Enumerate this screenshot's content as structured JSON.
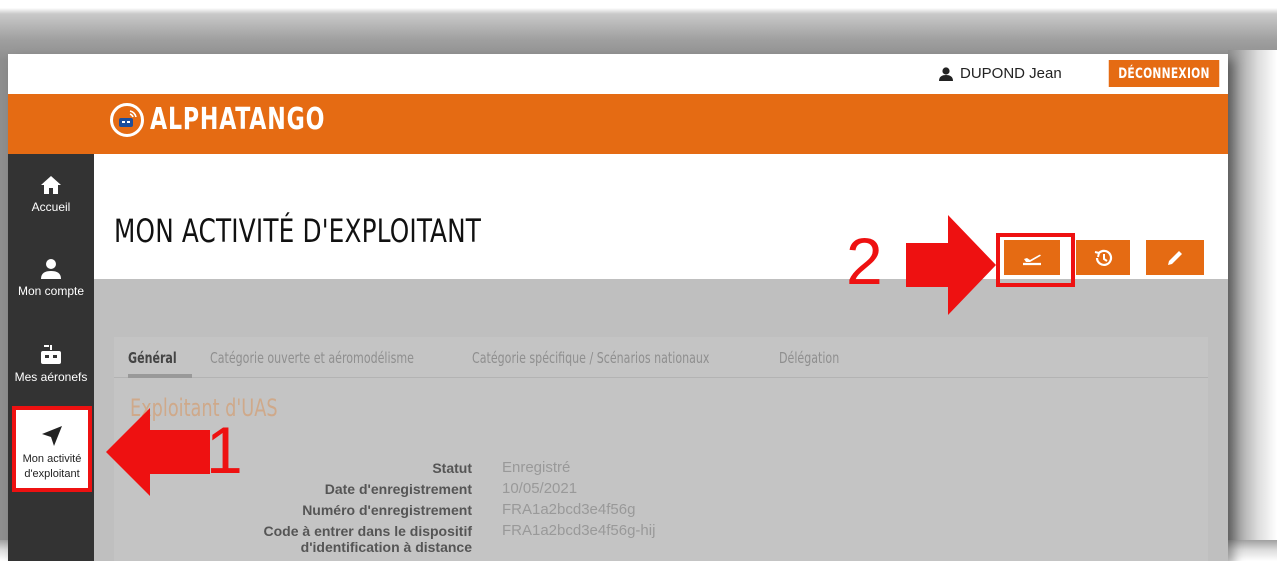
{
  "userbar": {
    "user_name": "DUPOND Jean",
    "logout_label": "DÉCONNEXION"
  },
  "header": {
    "logo_text": "ALPHATANGO"
  },
  "sidebar": {
    "items": [
      {
        "label": "Accueil",
        "icon": "home-icon"
      },
      {
        "label": "Mon compte",
        "icon": "user-icon"
      },
      {
        "label": "Mes aéronefs",
        "icon": "drone-icon"
      },
      {
        "label_line1": "Mon activité",
        "label_line2": "d'exploitant",
        "icon": "navigation-arrow-icon",
        "active": true
      }
    ]
  },
  "main": {
    "title": "MON ACTIVITÉ D'EXPLOITANT",
    "actions": [
      {
        "name": "flight-declaration",
        "icon": "takeoff-icon",
        "highlighted": true
      },
      {
        "name": "history",
        "icon": "history-icon"
      },
      {
        "name": "edit",
        "icon": "pencil-icon"
      }
    ],
    "tabs": [
      {
        "label": "Général",
        "selected": true
      },
      {
        "label": "Catégorie ouverte et aéromodélisme"
      },
      {
        "label": "Catégorie spécifique / Scénarios nationaux"
      },
      {
        "label": "Délégation"
      }
    ],
    "section_title": "Exploitant d'UAS",
    "fields": [
      {
        "label": "Statut",
        "value": "Enregistré"
      },
      {
        "label": "Date d'enregistrement",
        "value": "10/05/2021"
      },
      {
        "label": "Numéro d'enregistrement",
        "value": "FRA1a2bcd3e4f56g"
      },
      {
        "label_line1": "Code à entrer dans le dispositif",
        "label_line2": "d'identification à distance",
        "value": "FRA1a2bcd3e4f56g-hij"
      }
    ]
  },
  "annotations": {
    "step1": "1",
    "step2": "2"
  },
  "colors": {
    "accent": "#e56b13",
    "sidebar": "#333333",
    "highlight": "#ee1111",
    "overlay": "#bfbfbf"
  }
}
